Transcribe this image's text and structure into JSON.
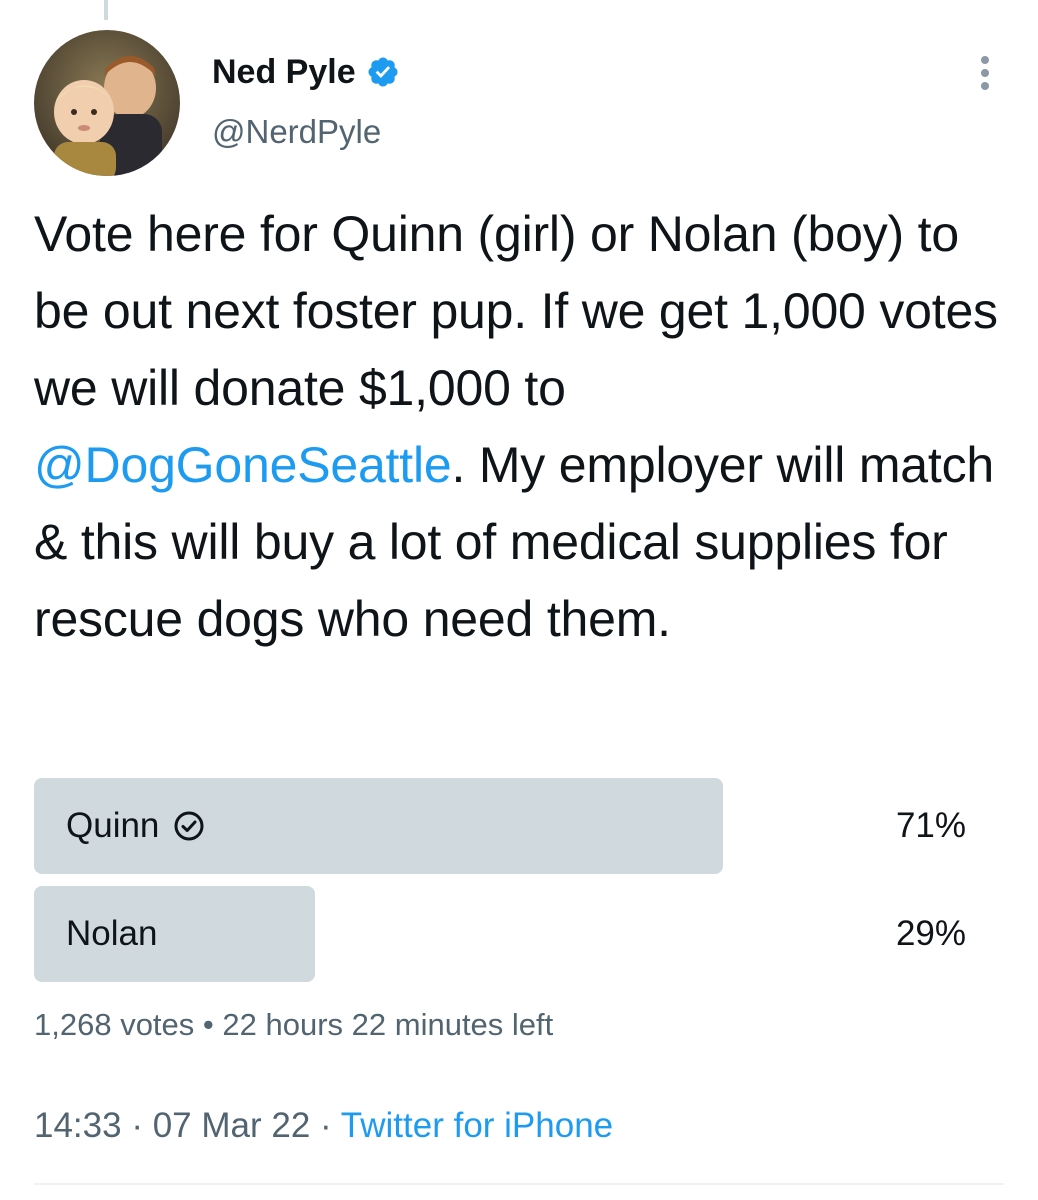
{
  "author": {
    "name": "Ned Pyle",
    "handle": "@NerdPyle",
    "verified": true
  },
  "tweet": {
    "text_before": "Vote here for Quinn (girl) or Nolan (boy) to be out next foster pup. If we get 1,000 votes we will donate $1,000 to ",
    "mention": "@DogGoneSeattle",
    "text_after": ". My employer will match & this will buy a lot of medical supplies for rescue dogs who need them."
  },
  "poll": {
    "options": [
      {
        "label": "Quinn",
        "percent_text": "71%",
        "percent": 71,
        "winner": true
      },
      {
        "label": "Nolan",
        "percent_text": "29%",
        "percent": 29,
        "winner": false
      }
    ],
    "votes": "1,268 votes",
    "separator": "•",
    "time_left": "22 hours 22 minutes left"
  },
  "meta": {
    "time": "14:33",
    "date": "07 Mar 22",
    "separator": "·",
    "source": "Twitter for iPhone"
  },
  "colors": {
    "accent": "#1d9bf0",
    "secondary_text": "#536471",
    "poll_bar": "#cfd9de"
  },
  "icons": {
    "verified": "verified-badge-icon",
    "more": "more-vertical-icon",
    "winner": "check-circle-icon"
  }
}
